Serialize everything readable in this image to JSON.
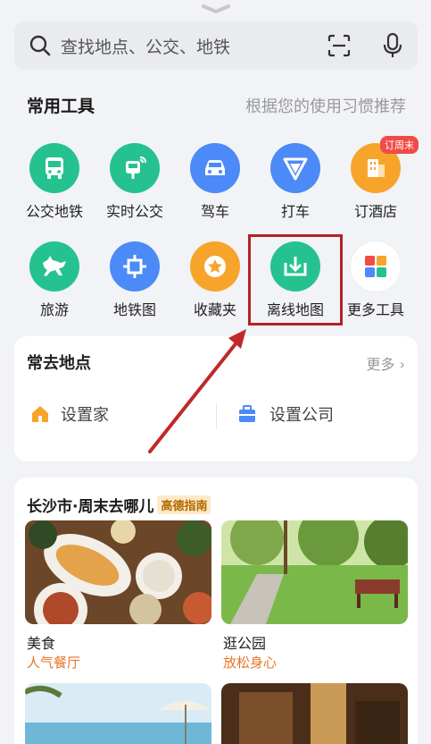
{
  "search": {
    "placeholder": "查找地点、公交、地铁"
  },
  "tools": {
    "title": "常用工具",
    "hint": "根据您的使用习惯推荐",
    "items": [
      {
        "label": "公交地铁",
        "color": "#25c28f",
        "icon": "bus-icon"
      },
      {
        "label": "实时公交",
        "color": "#25c28f",
        "icon": "realtime-bus-icon"
      },
      {
        "label": "驾车",
        "color": "#4b8af7",
        "icon": "car-icon"
      },
      {
        "label": "打车",
        "color": "#4b8af7",
        "icon": "taxi-icon"
      },
      {
        "label": "订酒店",
        "color": "#f7a42b",
        "icon": "hotel-icon",
        "badge": "订周末"
      },
      {
        "label": "旅游",
        "color": "#25c28f",
        "icon": "horse-icon"
      },
      {
        "label": "地铁图",
        "color": "#4b8af7",
        "icon": "subway-map-icon"
      },
      {
        "label": "收藏夹",
        "color": "#f7a42b",
        "icon": "star-icon"
      },
      {
        "label": "离线地图",
        "color": "#25c28f",
        "icon": "download-icon"
      },
      {
        "label": "更多工具",
        "color": "#ffffff",
        "icon": "grid-icon"
      }
    ]
  },
  "frequent": {
    "title": "常去地点",
    "more": "更多",
    "home": "设置家",
    "company": "设置公司"
  },
  "weekend": {
    "title": "长沙市·周末去哪儿",
    "tag": "高德指南",
    "cards": [
      {
        "title": "美食",
        "subtitle": "人气餐厅"
      },
      {
        "title": "逛公园",
        "subtitle": "放松身心"
      }
    ]
  }
}
